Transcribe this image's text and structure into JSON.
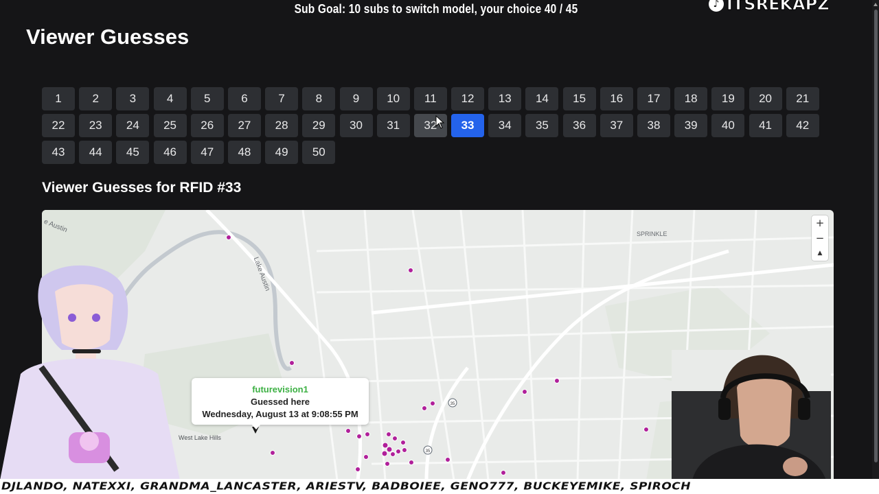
{
  "overlay": {
    "sub_goal": "Sub Goal: 10 subs to switch model, your choice  40 / 45",
    "handle": "ITSREKAPZ",
    "chat_ticker": "DJLANDO, NATEXXI, GRANDMA_LANCASTER, ARIESTV, BADBOIEE, GENO777, BUCKEYEMIKE, SPIROCH"
  },
  "page": {
    "title": "Viewer Guesses",
    "section_title": "Viewer Guesses for RFID #33"
  },
  "rfid": {
    "selected": "33",
    "hovered": "32",
    "buttons": [
      "1",
      "2",
      "3",
      "4",
      "5",
      "6",
      "7",
      "8",
      "9",
      "10",
      "11",
      "12",
      "13",
      "14",
      "15",
      "16",
      "17",
      "18",
      "19",
      "20",
      "21",
      "22",
      "23",
      "24",
      "25",
      "26",
      "27",
      "28",
      "29",
      "30",
      "31",
      "32",
      "33",
      "34",
      "35",
      "36",
      "37",
      "38",
      "39",
      "40",
      "41",
      "42",
      "43",
      "44",
      "45",
      "46",
      "47",
      "48",
      "49",
      "50"
    ]
  },
  "map": {
    "labels": {
      "austin": "e Austin",
      "lake_austin": "Lake Austin",
      "sprinkle": "SPRINKLE",
      "west_lake_hills": "West Lake Hills"
    },
    "controls": {
      "zoom_in": "+",
      "zoom_out": "−",
      "compass": "▲"
    },
    "popup": {
      "user": "futurevision1",
      "line": "Guessed here",
      "when": "Wednesday, August 13 at 9:08:55 PM"
    },
    "marker_color": "#b0209a",
    "highway_shields": [
      "35",
      "35"
    ]
  },
  "colors": {
    "background": "#151517",
    "button": "#2d2f33",
    "button_active": "#2463eb",
    "popup_user": "#3cb043"
  }
}
